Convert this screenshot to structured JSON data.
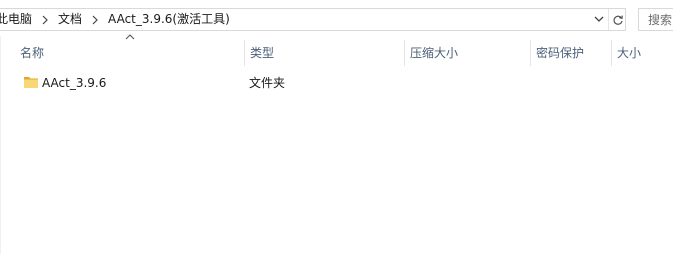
{
  "address_bar": {
    "breadcrumbs": [
      "此电脑",
      "文档",
      "AAct_3.9.6(激活工具)"
    ],
    "dropdown_icon": "chevron-down-icon",
    "refresh_icon": "refresh-icon"
  },
  "search": {
    "placeholder": "搜索"
  },
  "columns": {
    "name": "名称",
    "type": "类型",
    "compressed_size": "压缩大小",
    "password_protected": "密码保护",
    "size": "大小"
  },
  "sort": {
    "column": "name",
    "direction": "ascending"
  },
  "files": [
    {
      "name": "AAct_3.9.6",
      "type": "文件夹",
      "compressed_size": "",
      "password_protected": "",
      "size": "",
      "icon": "folder-icon"
    }
  ],
  "colors": {
    "header_text": "#4c607a",
    "folder_yellow": "#f8d775",
    "folder_dark": "#e0a82e",
    "border": "#d9d9d9"
  }
}
